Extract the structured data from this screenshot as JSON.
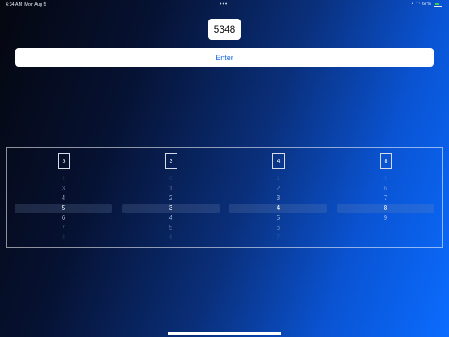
{
  "status": {
    "time": "6:34 AM",
    "date": "Mon Aug 5",
    "dots": "•••",
    "battery": "67%"
  },
  "code": "5348",
  "enter_label": "Enter",
  "pickers": [
    {
      "selected": "5",
      "wheel": [
        "2",
        "3",
        "4",
        "5",
        "6",
        "7",
        "8"
      ]
    },
    {
      "selected": "3",
      "wheel": [
        "0",
        "1",
        "2",
        "3",
        "4",
        "5",
        "6"
      ]
    },
    {
      "selected": "4",
      "wheel": [
        "1",
        "2",
        "3",
        "4",
        "5",
        "6",
        "7"
      ]
    },
    {
      "selected": "8",
      "wheel": [
        "5",
        "6",
        "7",
        "8",
        "9"
      ]
    }
  ]
}
